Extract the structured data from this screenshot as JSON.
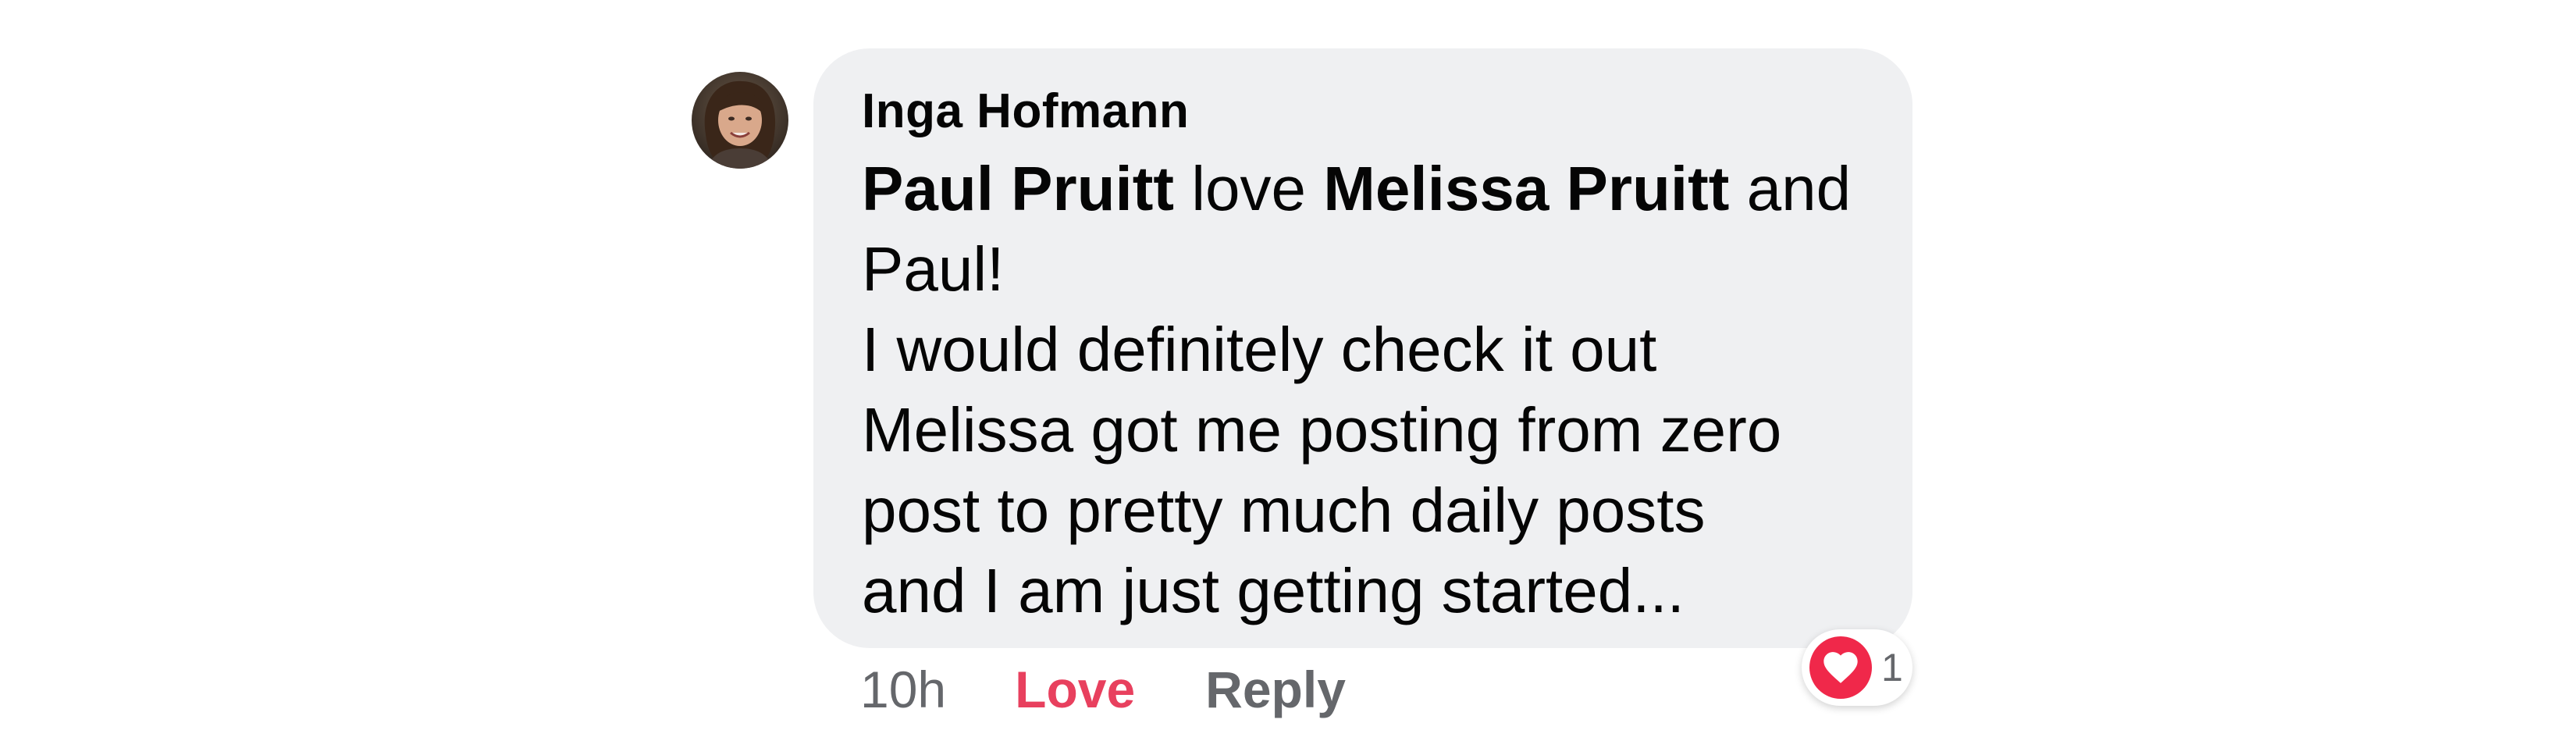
{
  "comment": {
    "author": "Inga Hofmann",
    "body_lines": [
      [
        {
          "text": "Paul Pruitt",
          "mention": true
        },
        {
          "text": " love ",
          "mention": false
        },
        {
          "text": "Melissa Pruitt",
          "mention": true
        },
        {
          "text": " and",
          "mention": false
        }
      ],
      [
        {
          "text": "Paul!",
          "mention": false
        }
      ],
      [
        {
          "text": "I would definitely check it out",
          "mention": false
        }
      ],
      [
        {
          "text": "Melissa got me posting from zero",
          "mention": false
        }
      ],
      [
        {
          "text": "post to pretty much daily posts",
          "mention": false
        }
      ],
      [
        {
          "text": "and I am just getting started...",
          "mention": false
        }
      ]
    ],
    "timestamp": "10h",
    "love_label": "Love",
    "reply_label": "Reply",
    "reaction": {
      "icon": "heart-icon",
      "count": "1"
    }
  },
  "colors": {
    "bubble_bg": "#eff0f2",
    "love_accent": "#e8405e",
    "heart_badge": "#f0284a",
    "meta_gray": "#65676b"
  }
}
